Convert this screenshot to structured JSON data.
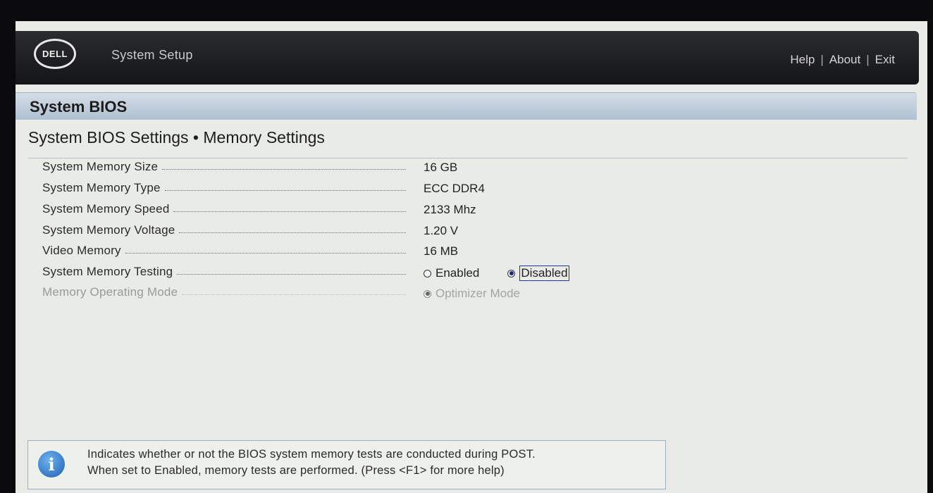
{
  "header": {
    "logo_text": "DELL",
    "app_title": "System Setup",
    "links": {
      "help": "Help",
      "about": "About",
      "exit": "Exit"
    },
    "separator": "|"
  },
  "section_title": "System BIOS",
  "page_title": "System BIOS Settings • Memory Settings",
  "settings": [
    {
      "label": "System Memory Size",
      "value": "16 GB"
    },
    {
      "label": "System Memory Type",
      "value": "ECC DDR4"
    },
    {
      "label": "System Memory Speed",
      "value": "2133 Mhz"
    },
    {
      "label": "System Memory Voltage",
      "value": "1.20 V"
    },
    {
      "label": "Video Memory",
      "value": "16 MB"
    },
    {
      "label": "System Memory Testing",
      "options": [
        "Enabled",
        "Disabled"
      ],
      "selected": "Disabled"
    },
    {
      "label": "Memory Operating Mode",
      "options": [
        "Optimizer Mode"
      ],
      "selected": "Optimizer Mode",
      "disabled": true
    }
  ],
  "help": {
    "line1": "Indicates whether or not the BIOS system memory tests are conducted during POST.",
    "line2": "When set to Enabled, memory tests are performed. (Press <F1> for more help)"
  }
}
